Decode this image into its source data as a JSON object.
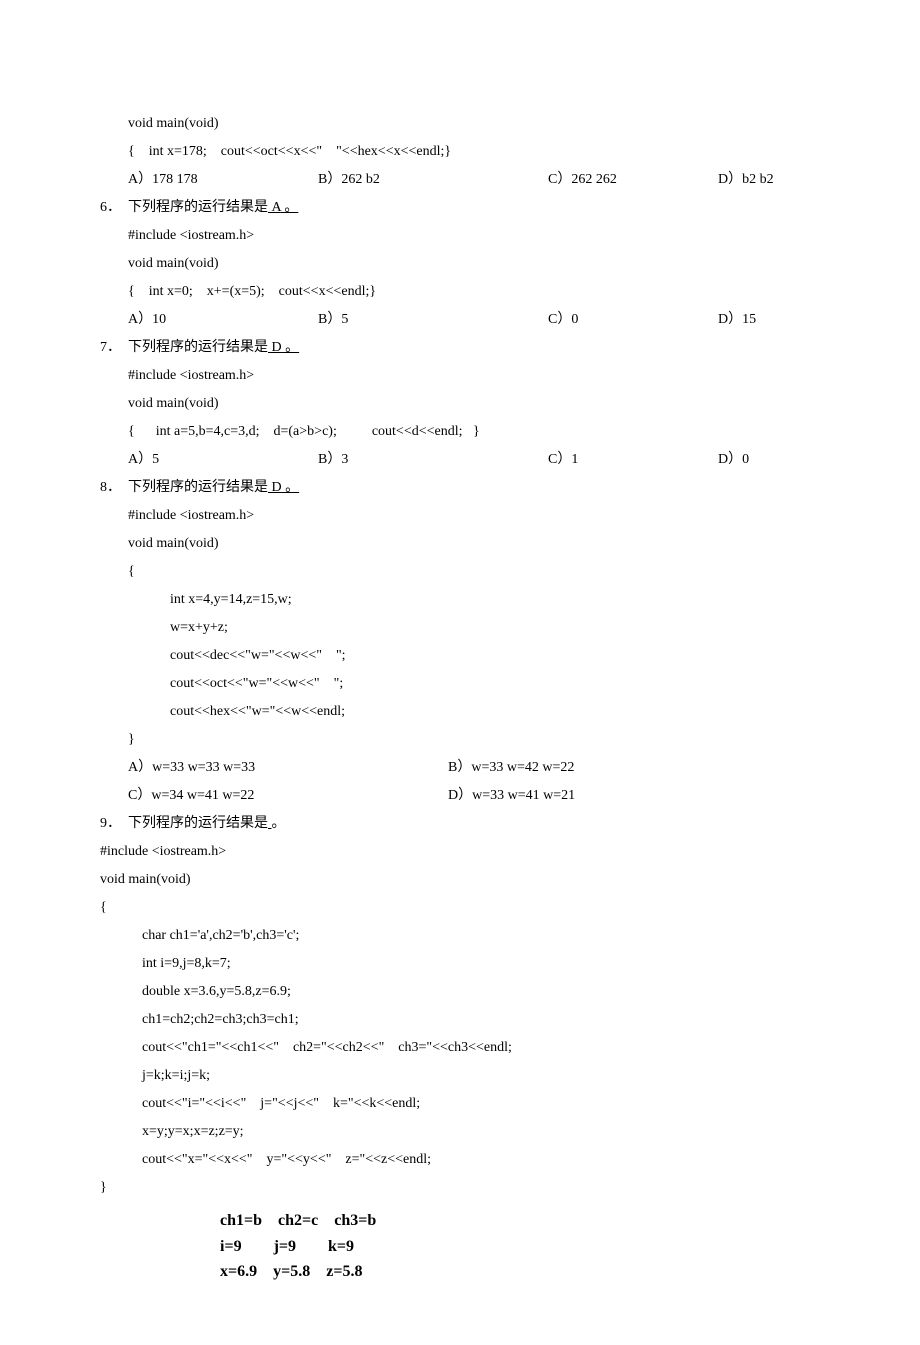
{
  "q5": {
    "code1": "void main(void)",
    "code2": "{    int x=178;    cout<<oct<<x<<\"    \"<<hex<<x<<endl;}",
    "opts": {
      "a": "A）178    178",
      "b": "B）262    b2",
      "c": "C）262    262",
      "d": "D）b2    b2"
    }
  },
  "q6": {
    "num": "6．",
    "stem_pre": "下列程序的运行结果是",
    "ans": "    A",
    "stem_post": "           。",
    "code1": "#include <iostream.h>",
    "code2": "void main(void)",
    "code3": "{    int x=0;    x+=(x=5);    cout<<x<<endl;}",
    "opts": {
      "a": "A）10",
      "b": "B）5",
      "c": "C）0",
      "d": "D）15"
    }
  },
  "q7": {
    "num": "7．",
    "stem_pre": "下列程序的运行结果是",
    "ans": "    D",
    "stem_post": "           。",
    "code1": "#include <iostream.h>",
    "code2": "void main(void)",
    "code3": "{      int a=5,b=4,c=3,d;    d=(a>b>c);          cout<<d<<endl;   }",
    "opts": {
      "a": "A）5",
      "b": "B）3",
      "c": "C）1",
      "d": "D）0"
    }
  },
  "q8": {
    "num": "8．",
    "stem_pre": "下列程序的运行结果是",
    "ans": "    D",
    "stem_post": "              。",
    "code1": "#include <iostream.h>",
    "code2": "void main(void)",
    "code3": "{",
    "code4": "int x=4,y=14,z=15,w;",
    "code5": "w=x+y+z;",
    "code6": "cout<<dec<<\"w=\"<<w<<\"    \";",
    "code7": "cout<<oct<<\"w=\"<<w<<\"    \";",
    "code8": "cout<<hex<<\"w=\"<<w<<endl;",
    "code9": "}",
    "opts": {
      "a": "A）w=33    w=33    w=33",
      "b": "B）w=33    w=42    w=22",
      "c": "C）w=34    w=41    w=22",
      "d": "D）w=33    w=41    w=21"
    }
  },
  "q9": {
    "num": "9．",
    "stem_pre": "下列程序的运行结果是",
    "blank": "                          ",
    "stem_post": "。",
    "code1": "#include <iostream.h>",
    "code2": "void main(void)",
    "code3": "{",
    "code4": "char ch1='a',ch2='b',ch3='c';",
    "code5": "int i=9,j=8,k=7;",
    "code6": "double x=3.6,y=5.8,z=6.9;",
    "code7": "ch1=ch2;ch2=ch3;ch3=ch1;",
    "code8": "cout<<\"ch1=\"<<ch1<<\"    ch2=\"<<ch2<<\"    ch3=\"<<ch3<<endl;",
    "code9": "j=k;k=i;j=k;",
    "code10": "cout<<\"i=\"<<i<<\"    j=\"<<j<<\"    k=\"<<k<<endl;",
    "code11": "x=y;y=x;x=z;z=y;",
    "code12": "cout<<\"x=\"<<x<<\"    y=\"<<y<<\"    z=\"<<z<<endl;",
    "code13": "}",
    "ans1": "ch1=b    ch2=c    ch3=b",
    "ans2": "i=9        j=9        k=9",
    "ans3": "x=6.9    y=5.8    z=5.8"
  }
}
